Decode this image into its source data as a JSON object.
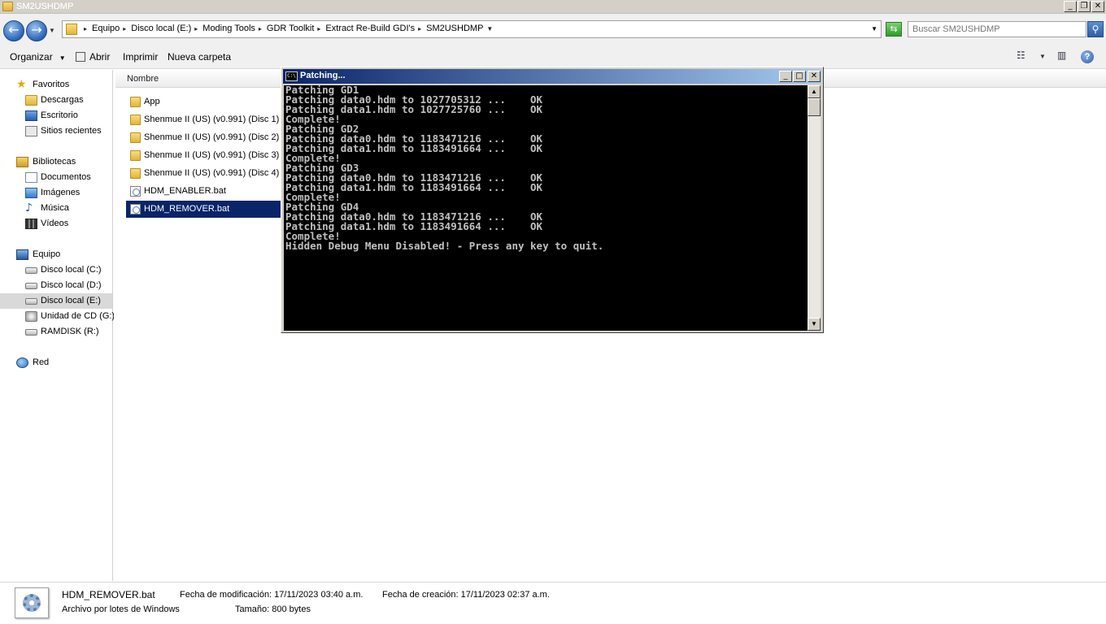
{
  "window": {
    "title": "SM2USHDMP"
  },
  "address": {
    "crumbs": [
      "Equipo",
      "Disco local (E:)",
      "Moding Tools",
      "GDR Toolkit",
      "Extract Re-Build GDI's",
      "SM2USHDMP"
    ]
  },
  "search": {
    "placeholder": "Buscar SM2USHDMP"
  },
  "toolbar": {
    "organize": "Organizar",
    "open": "Abrir",
    "print": "Imprimir",
    "new_folder": "Nueva carpeta"
  },
  "nav": {
    "favorites": "Favoritos",
    "downloads": "Descargas",
    "desktop": "Escritorio",
    "recent": "Sitios recientes",
    "libraries": "Bibliotecas",
    "documents": "Documentos",
    "images": "Imágenes",
    "music": "Música",
    "videos": "Vídeos",
    "computer": "Equipo",
    "drive_c": "Disco local (C:)",
    "drive_d": "Disco local (D:)",
    "drive_e": "Disco local (E:)",
    "drive_g": "Unidad de CD (G:)",
    "drive_r": "RAMDISK (R:)",
    "network": "Red"
  },
  "columns": {
    "name": "Nombre"
  },
  "files": [
    "App",
    "Shenmue II (US) (v0.991) (Disc 1)",
    "Shenmue II (US) (v0.991) (Disc 2)",
    "Shenmue II (US) (v0.991) (Disc 3)",
    "Shenmue II (US) (v0.991) (Disc 4)",
    "HDM_ENABLER.bat",
    "HDM_REMOVER.bat"
  ],
  "console": {
    "title": "Patching...",
    "lines": [
      "Patching GD1",
      "Patching data0.hdm to 1027705312 ...    OK",
      "Patching data1.hdm to 1027725760 ...    OK",
      "Complete!",
      "Patching GD2",
      "Patching data0.hdm to 1183471216 ...    OK",
      "Patching data1.hdm to 1183491664 ...    OK",
      "Complete!",
      "Patching GD3",
      "Patching data0.hdm to 1183471216 ...    OK",
      "Patching data1.hdm to 1183491664 ...    OK",
      "Complete!",
      "Patching GD4",
      "Patching data0.hdm to 1183471216 ...    OK",
      "Patching data1.hdm to 1183491664 ...    OK",
      "Complete!",
      "Hidden Debug Menu Disabled! - Press any key to quit."
    ]
  },
  "details": {
    "filename": "HDM_REMOVER.bat",
    "type": "Archivo por lotes de Windows",
    "modified": "Fecha de modificación: 17/11/2023 03:40 a.m.",
    "created": "Fecha de creación: 17/11/2023 02:37 a.m.",
    "size": "Tamaño: 800 bytes"
  }
}
